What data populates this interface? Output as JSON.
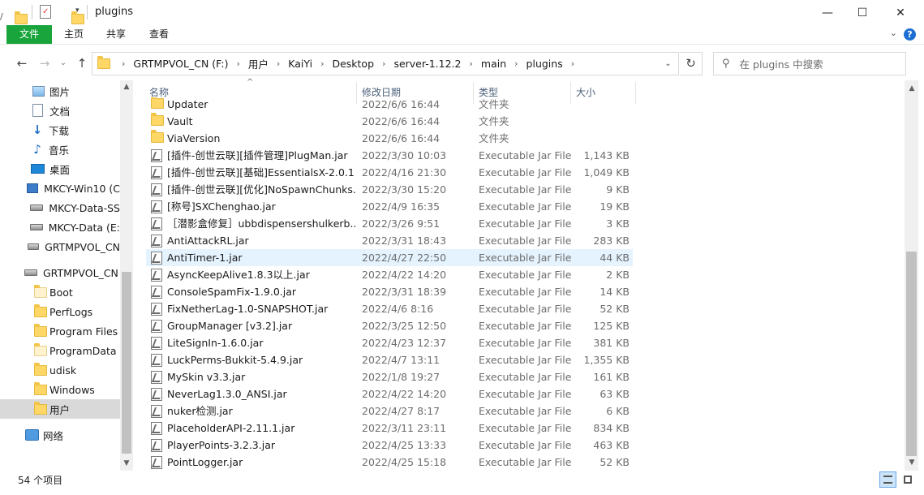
{
  "window": {
    "title": "plugins",
    "controls": {
      "minimize": "—",
      "maximize": "☐",
      "close": "✕"
    }
  },
  "ribbon": {
    "tabs": [
      "文件",
      "主页",
      "共享",
      "查看"
    ],
    "help": "?"
  },
  "address": {
    "crumbs": [
      "GRTMPVOL_CN (F:)",
      "用户",
      "KaiYi",
      "Desktop",
      "server-1.12.2",
      "main",
      "plugins"
    ]
  },
  "search": {
    "placeholder": "在 plugins 中搜索"
  },
  "nav": {
    "items": [
      {
        "label": "图片",
        "icon": "pictures-icon"
      },
      {
        "label": "文档",
        "icon": "documents-icon"
      },
      {
        "label": "下载",
        "icon": "download-icon"
      },
      {
        "label": "音乐",
        "icon": "music-icon"
      },
      {
        "label": "桌面",
        "icon": "desktop-icon"
      },
      {
        "label": "MKCY-Win10 (C",
        "icon": "system-drive-icon"
      },
      {
        "label": "MKCY-Data-SS",
        "icon": "drive-icon"
      },
      {
        "label": "MKCY-Data (E:",
        "icon": "drive-icon"
      },
      {
        "label": "GRTMPVOL_CN",
        "icon": "drive-icon"
      },
      {
        "label": "GRTMPVOL_CN",
        "icon": "drive-icon"
      },
      {
        "label": "Boot",
        "icon": "folder-icon"
      },
      {
        "label": "PerfLogs",
        "icon": "folder-icon"
      },
      {
        "label": "Program Files",
        "icon": "folder-icon"
      },
      {
        "label": "ProgramData",
        "icon": "folder-icon"
      },
      {
        "label": "udisk",
        "icon": "folder-icon"
      },
      {
        "label": "Windows",
        "icon": "folder-icon"
      },
      {
        "label": "用户",
        "icon": "folder-icon"
      },
      {
        "label": "网络",
        "icon": "network-icon"
      }
    ]
  },
  "columns": {
    "name": "名称",
    "date": "修改日期",
    "type": "类型",
    "size": "大小"
  },
  "files": [
    {
      "name": "Updater",
      "date": "2022/6/6 16:44",
      "type": "文件夹",
      "size": "",
      "kind": "folder"
    },
    {
      "name": "Vault",
      "date": "2022/6/6 16:44",
      "type": "文件夹",
      "size": "",
      "kind": "folder"
    },
    {
      "name": "ViaVersion",
      "date": "2022/6/6 16:44",
      "type": "文件夹",
      "size": "",
      "kind": "folder"
    },
    {
      "name": "[插件-创世云联][插件管理]PlugMan.jar",
      "date": "2022/3/30 10:03",
      "type": "Executable Jar File",
      "size": "1,143 KB",
      "kind": "jar"
    },
    {
      "name": "[插件-创世云联][基础]EssentialsX-2.0.1....",
      "date": "2022/4/16 21:30",
      "type": "Executable Jar File",
      "size": "1,049 KB",
      "kind": "jar"
    },
    {
      "name": "[插件-创世云联][优化]NoSpawnChunks....",
      "date": "2022/3/30 15:20",
      "type": "Executable Jar File",
      "size": "9 KB",
      "kind": "jar"
    },
    {
      "name": "[称号]SXChenghao.jar",
      "date": "2022/4/9 16:35",
      "type": "Executable Jar File",
      "size": "19 KB",
      "kind": "jar"
    },
    {
      "name": "［潜影盒修复］ubbdispensershulkerb...",
      "date": "2022/3/26 9:51",
      "type": "Executable Jar File",
      "size": "3 KB",
      "kind": "jar"
    },
    {
      "name": "AntiAttackRL.jar",
      "date": "2022/3/31 18:43",
      "type": "Executable Jar File",
      "size": "283 KB",
      "kind": "jar"
    },
    {
      "name": "AntiTimer-1.jar",
      "date": "2022/4/27 22:50",
      "type": "Executable Jar File",
      "size": "44 KB",
      "kind": "jar"
    },
    {
      "name": "AsyncKeepAlive1.8.3以上.jar",
      "date": "2022/4/22 14:20",
      "type": "Executable Jar File",
      "size": "2 KB",
      "kind": "jar"
    },
    {
      "name": "ConsoleSpamFix-1.9.0.jar",
      "date": "2022/3/31 18:39",
      "type": "Executable Jar File",
      "size": "14 KB",
      "kind": "jar"
    },
    {
      "name": "FixNetherLag-1.0-SNAPSHOT.jar",
      "date": "2022/4/6 8:16",
      "type": "Executable Jar File",
      "size": "52 KB",
      "kind": "jar"
    },
    {
      "name": "GroupManager [v3.2].jar",
      "date": "2022/3/25 12:50",
      "type": "Executable Jar File",
      "size": "125 KB",
      "kind": "jar"
    },
    {
      "name": "LiteSignIn-1.6.0.jar",
      "date": "2022/4/23 12:37",
      "type": "Executable Jar File",
      "size": "381 KB",
      "kind": "jar"
    },
    {
      "name": "LuckPerms-Bukkit-5.4.9.jar",
      "date": "2022/4/7 13:11",
      "type": "Executable Jar File",
      "size": "1,355 KB",
      "kind": "jar"
    },
    {
      "name": "MySkin v3.3.jar",
      "date": "2022/1/8 19:27",
      "type": "Executable Jar File",
      "size": "161 KB",
      "kind": "jar"
    },
    {
      "name": "NeverLag1.3.0_ANSI.jar",
      "date": "2022/4/22 14:20",
      "type": "Executable Jar File",
      "size": "63 KB",
      "kind": "jar"
    },
    {
      "name": "nuker检测.jar",
      "date": "2022/4/27 8:17",
      "type": "Executable Jar File",
      "size": "6 KB",
      "kind": "jar"
    },
    {
      "name": "PlaceholderAPI-2.11.1.jar",
      "date": "2022/3/11 23:11",
      "type": "Executable Jar File",
      "size": "834 KB",
      "kind": "jar"
    },
    {
      "name": "PlayerPoints-3.2.3.jar",
      "date": "2022/4/25 13:33",
      "type": "Executable Jar File",
      "size": "463 KB",
      "kind": "jar"
    },
    {
      "name": "PointLogger.jar",
      "date": "2022/4/25 15:18",
      "type": "Executable Jar File",
      "size": "52 KB",
      "kind": "jar"
    }
  ],
  "status": {
    "count": "54 个项目"
  },
  "colors": {
    "file_tab": "#19a43c",
    "selection": "#d9d9d9",
    "hover_row": "#e5f3ff",
    "help": "#1d6fd1"
  }
}
